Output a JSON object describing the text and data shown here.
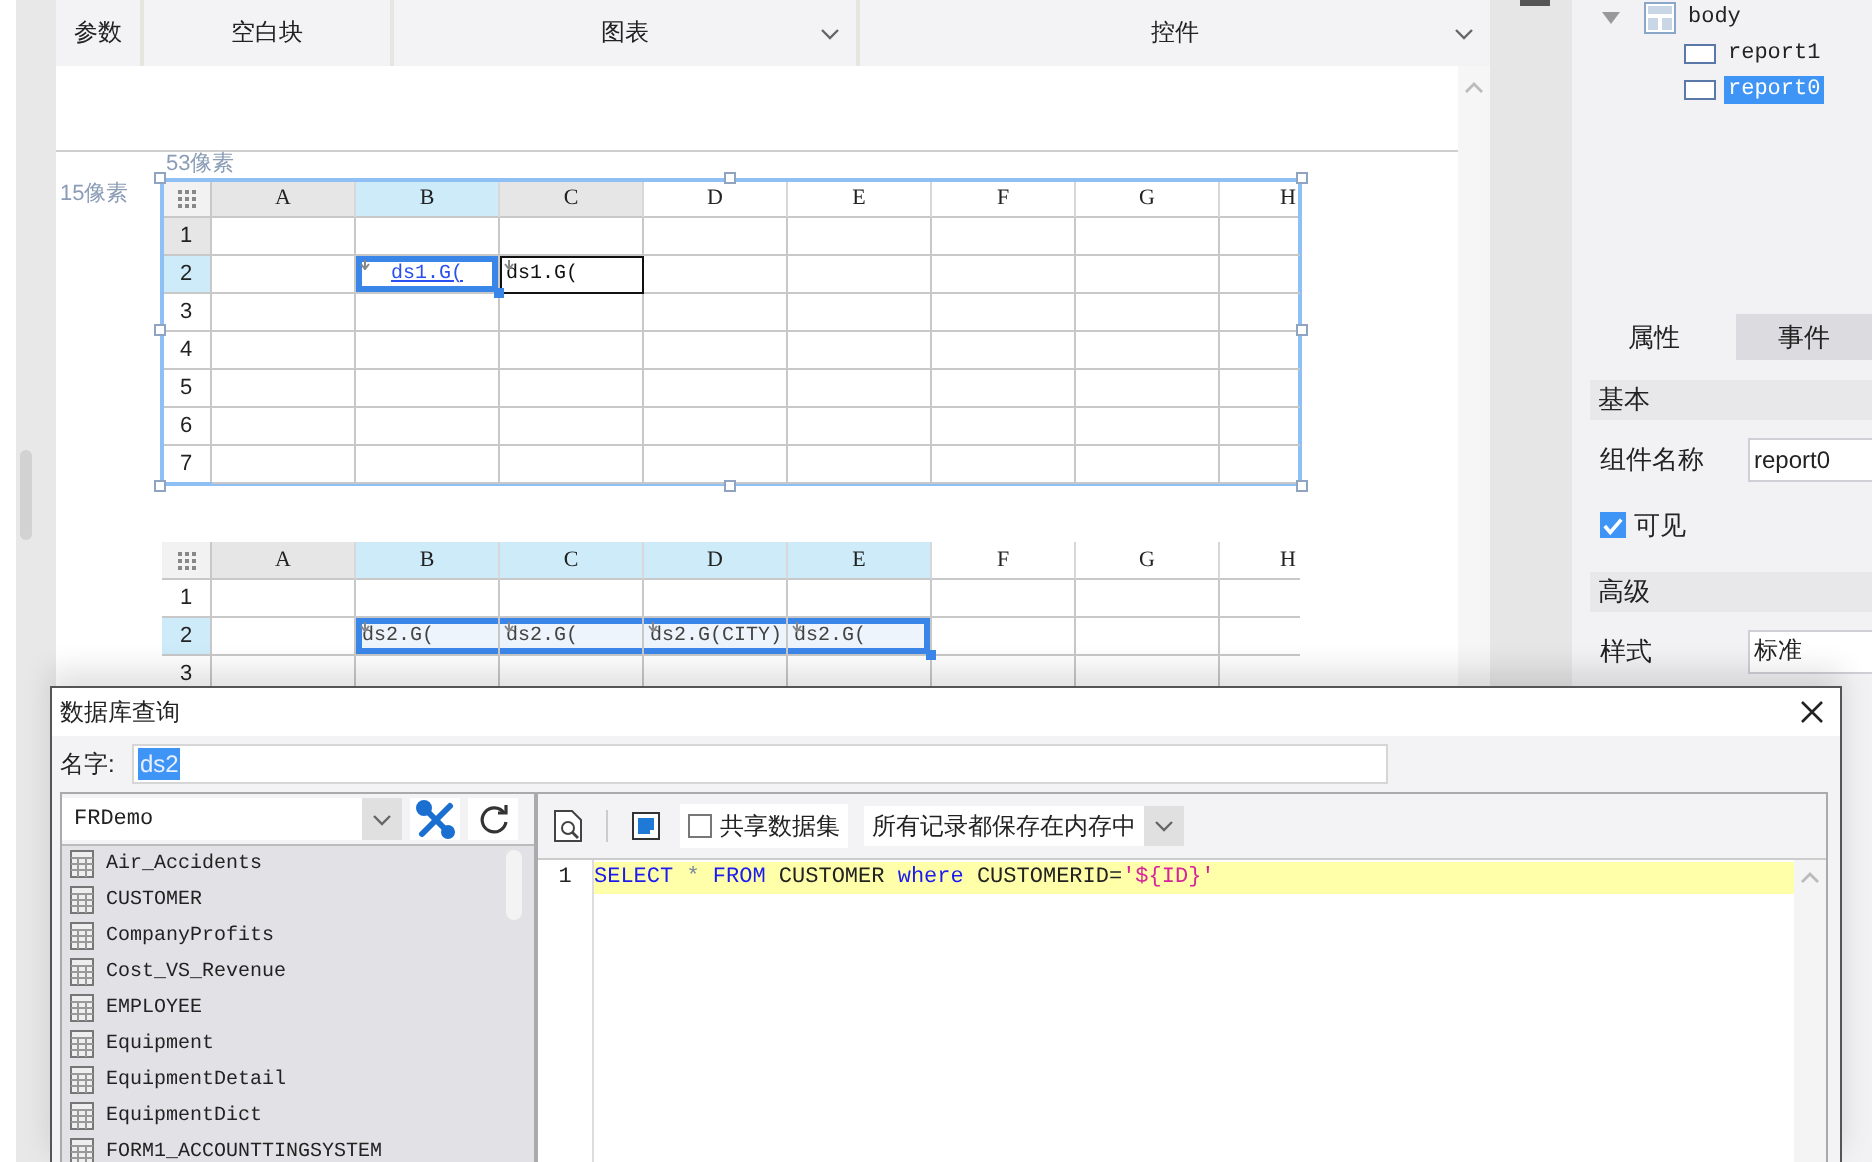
{
  "toolbar": {
    "tabs": [
      {
        "label": "参数",
        "dropdown": false
      },
      {
        "label": "空白块",
        "dropdown": false
      },
      {
        "label": "图表",
        "dropdown": true
      },
      {
        "label": "控件",
        "dropdown": true
      }
    ]
  },
  "canvas": {
    "left_offset": "53像素",
    "top_offset": "15像素",
    "reports": [
      {
        "selected": true,
        "columns": [
          {
            "label": "A",
            "in_use": true,
            "selected": false
          },
          {
            "label": "B",
            "in_use": false,
            "selected": true
          },
          {
            "label": "C",
            "in_use": true,
            "selected": false
          },
          {
            "label": "D",
            "in_use": false,
            "selected": false
          },
          {
            "label": "E",
            "in_use": false,
            "selected": false
          },
          {
            "label": "F",
            "in_use": false,
            "selected": false
          },
          {
            "label": "G",
            "in_use": false,
            "selected": false
          },
          {
            "label": "H",
            "in_use": false,
            "selected": false
          }
        ],
        "rows": [
          {
            "label": "1",
            "in_use": true,
            "selected": false
          },
          {
            "label": "2",
            "in_use": false,
            "selected": true,
            "cells": [
              {},
              {
                "text": "ds1.G(",
                "kind": "expand",
                "selected": true,
                "hyperlink": true,
                "framed": false
              },
              {
                "text": "ds1.G(",
                "kind": "expand",
                "selected": false,
                "hyperlink": false,
                "framed": true
              }
            ]
          },
          {
            "label": "3",
            "in_use": false,
            "selected": false
          },
          {
            "label": "4",
            "in_use": false,
            "selected": false
          },
          {
            "label": "5",
            "in_use": false,
            "selected": false
          },
          {
            "label": "6",
            "in_use": false,
            "selected": false
          },
          {
            "label": "7",
            "in_use": false,
            "selected": false
          }
        ]
      },
      {
        "selected": false,
        "columns": [
          {
            "label": "A",
            "in_use": true,
            "selected": false
          },
          {
            "label": "B",
            "in_use": false,
            "selected": true
          },
          {
            "label": "C",
            "in_use": false,
            "selected": true
          },
          {
            "label": "D",
            "in_use": false,
            "selected": true
          },
          {
            "label": "E",
            "in_use": false,
            "selected": true
          },
          {
            "label": "F",
            "in_use": false,
            "selected": false
          },
          {
            "label": "G",
            "in_use": false,
            "selected": false
          },
          {
            "label": "H",
            "in_use": false,
            "selected": false
          }
        ],
        "rows": [
          {
            "label": "1",
            "in_use": false,
            "selected": false
          },
          {
            "label": "2",
            "in_use": false,
            "selected": true,
            "cells": [
              {},
              {
                "text": "ds2.G(",
                "kind": "expand",
                "selected": true,
                "hyperlink": false,
                "framed": false
              },
              {
                "text": "ds2.G(",
                "kind": "expand",
                "selected": true,
                "hyperlink": false,
                "framed": false
              },
              {
                "text": "ds2.G(CITY)",
                "kind": "expand",
                "selected": true,
                "hyperlink": false,
                "framed": false
              },
              {
                "text": "ds2.G(",
                "kind": "expand",
                "selected": true,
                "hyperlink": false,
                "framed": false
              }
            ]
          },
          {
            "label": "3",
            "in_use": false,
            "selected": false
          }
        ]
      }
    ]
  },
  "component_tree": {
    "label": "body",
    "expanded": true,
    "children": [
      {
        "label": "report1",
        "selected": false
      },
      {
        "label": "report0",
        "selected": true
      }
    ]
  },
  "property_panel": {
    "tabs": [
      {
        "label": "属性",
        "selected": true
      },
      {
        "label": "事件",
        "selected": false
      }
    ],
    "sections": [
      {
        "title": "基本",
        "rows": [
          {
            "kind": "text",
            "label": "组件名称",
            "value": "report0"
          },
          {
            "kind": "checkbox",
            "label": "可见",
            "checked": true
          }
        ]
      },
      {
        "title": "高级",
        "rows": [
          {
            "kind": "text",
            "label": "样式",
            "value": "标准"
          }
        ]
      }
    ]
  },
  "dialog": {
    "title": "数据库查询",
    "name_label": "名字:",
    "name_value": "ds2",
    "name_value_selected": true,
    "connection": "FRDemo",
    "tables": [
      "Air_Accidents",
      "CUSTOMER",
      "CompanyProfits",
      "Cost_VS_Revenue",
      "EMPLOYEE",
      "Equipment",
      "EquipmentDetail",
      "EquipmentDict",
      "FORM1_ACCOUNTTINGSYSTEM"
    ],
    "share_dataset": {
      "label": "共享数据集",
      "checked": false
    },
    "storage_mode": "所有记录都保存在内存中",
    "sql_lines": [
      {
        "number": "1",
        "highlighted": true,
        "tokens": [
          {
            "kind": "keyword",
            "text": "SELECT"
          },
          {
            "kind": "operator",
            "text": " * "
          },
          {
            "kind": "keyword",
            "text": "FROM"
          },
          {
            "kind": "plain",
            "text": " CUSTOMER "
          },
          {
            "kind": "keyword",
            "text": "where"
          },
          {
            "kind": "plain",
            "text": " CUSTOMERID="
          },
          {
            "kind": "string",
            "text": "'${ID}'"
          }
        ]
      }
    ]
  }
}
